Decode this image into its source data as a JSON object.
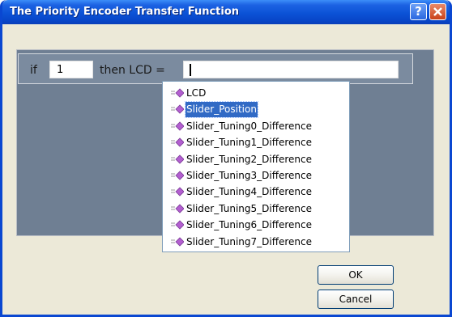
{
  "window": {
    "title": "The Priority Encoder Transfer Function"
  },
  "titlebar": {
    "help_symbol": "?"
  },
  "condition": {
    "if_label": "if",
    "if_value": "1",
    "then_label": "then LCD ="
  },
  "dropdown": {
    "selected_index": 1,
    "items": [
      "LCD",
      "Slider_Position",
      "Slider_Tuning0_Difference",
      "Slider_Tuning1_Difference",
      "Slider_Tuning2_Difference",
      "Slider_Tuning3_Difference",
      "Slider_Tuning4_Difference",
      "Slider_Tuning5_Difference",
      "Slider_Tuning6_Difference",
      "Slider_Tuning7_Difference"
    ]
  },
  "buttons": {
    "ok": "OK",
    "cancel": "Cancel"
  },
  "colors": {
    "title_bar": "#0b52d6",
    "panel": "#6f7f93",
    "selection": "#316ac5",
    "item_icon": "#b35fd0"
  }
}
